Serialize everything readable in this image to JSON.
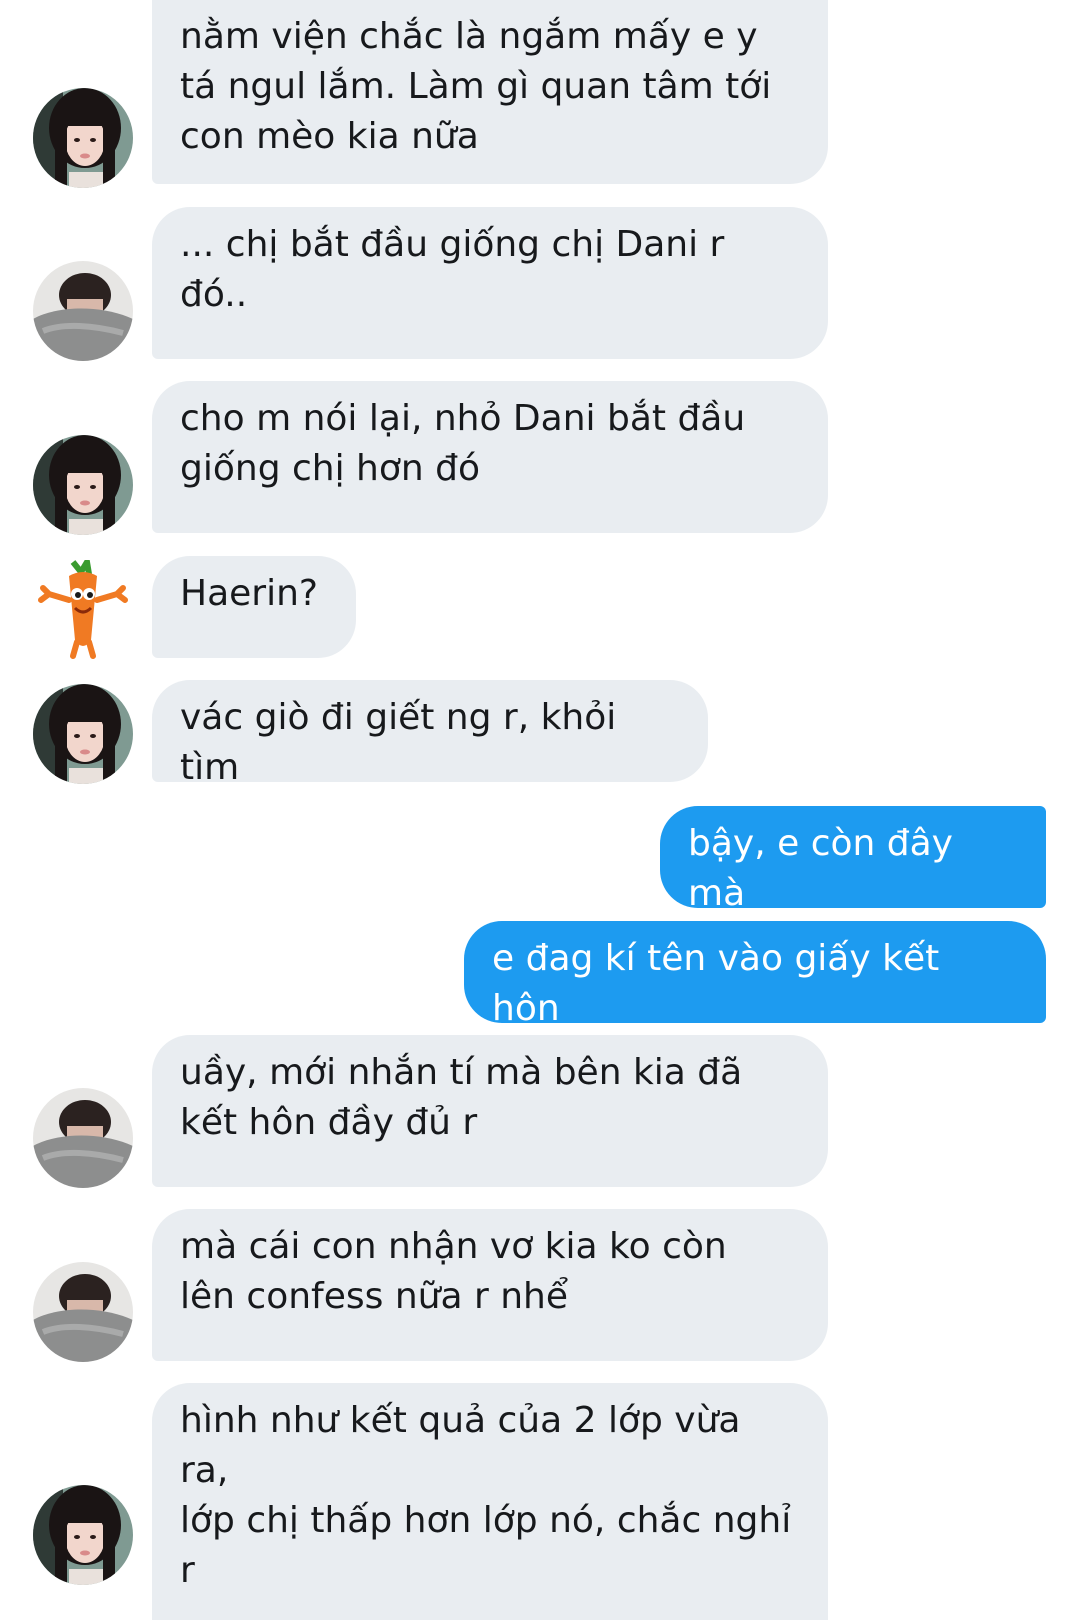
{
  "conversation": {
    "messages": [
      {
        "sender": "girl",
        "text": "nằm viện chắc là ngắm mấy e y\ntá ngul lắm. Làm gì quan tâm tới\ncon mèo kia nữa"
      },
      {
        "sender": "blanket",
        "text": "... chị bắt đầu giống chị Dani r\nđó.."
      },
      {
        "sender": "girl",
        "text": "cho m nói lại, nhỏ Dani bắt đầu\ngiống chị hơn đó"
      },
      {
        "sender": "carrot",
        "text": "Haerin?"
      },
      {
        "sender": "girl",
        "text": "vác giò đi giết ng r, khỏi tìm"
      },
      {
        "sender": "me",
        "text": "bậy, e còn đây mà"
      },
      {
        "sender": "me",
        "text": "e đag kí tên vào giấy kết hôn"
      },
      {
        "sender": "blanket",
        "text": "uầy, mới nhắn tí mà bên kia đã\nkết hôn đầy đủ r"
      },
      {
        "sender": "blanket",
        "text": "mà cái con nhận vơ kia ko còn\nlên confess nữa r nhể"
      },
      {
        "sender": "girl",
        "text": "hình như kết quả của 2 lớp vừa ra,\nlớp chị thấp hơn lớp nó, chắc nghỉ\nr"
      }
    ]
  },
  "avatars": {
    "girl": "girl-avatar-icon",
    "blanket": "blanket-avatar-icon",
    "carrot": "carrot-mascot-icon"
  },
  "colors": {
    "incoming_bubble": "#e9edf1",
    "outgoing_bubble": "#1d9bf0",
    "incoming_text": "#17191c",
    "outgoing_text": "#ffffff",
    "background": "#ffffff"
  }
}
